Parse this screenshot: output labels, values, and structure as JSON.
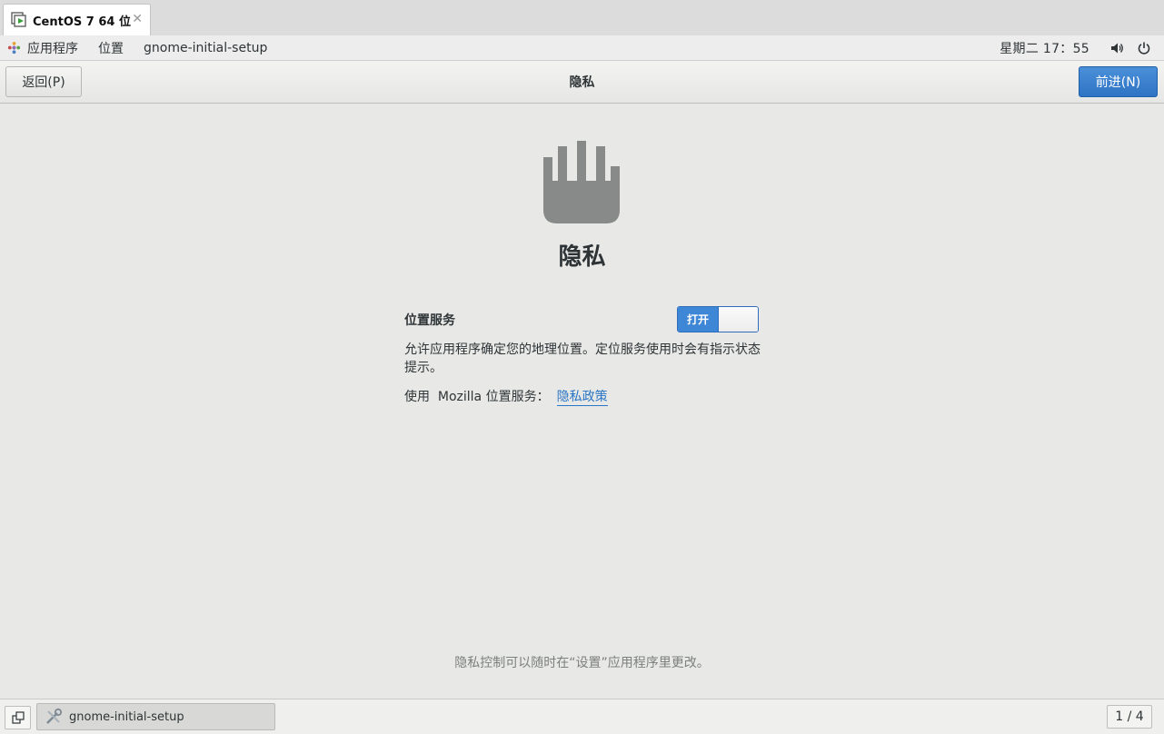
{
  "vm_tab": {
    "title": "CentOS 7 64 位",
    "icon": "vm-icon",
    "close_icon": "close-icon"
  },
  "top_panel": {
    "apps_label": "应用程序",
    "places_label": "位置",
    "app_name": "gnome-initial-setup",
    "clock": "星期二 17：55",
    "volume_icon": "volume-icon",
    "power_icon": "power-icon"
  },
  "header": {
    "back_label": "返回(P)",
    "title": "隐私",
    "next_label": "前进(N)"
  },
  "main": {
    "icon": "hand-stop-icon",
    "heading": "隐私",
    "location": {
      "label": "位置服务",
      "toggle_state": "打开",
      "description": "允许应用程序确定您的地理位置。定位服务使用时会有指示状态提示。",
      "mozilla_text": "使用  Mozilla 位置服务：",
      "privacy_link": "隐私政策"
    },
    "footer_note": "隐私控制可以随时在“设置”应用程序里更改。"
  },
  "taskbar": {
    "task_label": "gnome-initial-setup",
    "workspace": "1 / 4"
  },
  "colors": {
    "accent": "#3e86d6",
    "background": "#e8e8e7",
    "link": "#2a76c6"
  }
}
